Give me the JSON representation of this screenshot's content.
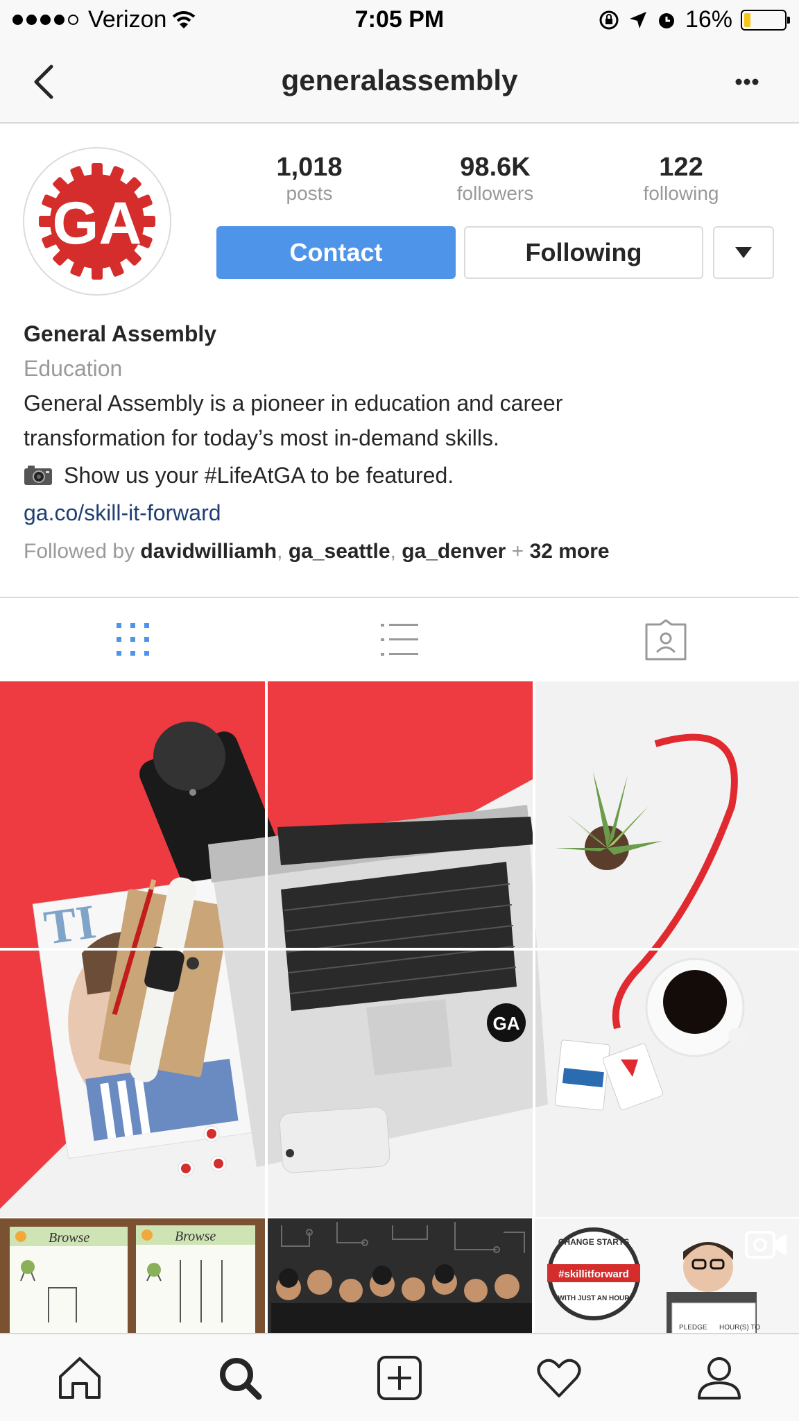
{
  "status_bar": {
    "carrier": "Verizon",
    "time": "7:05 PM",
    "battery": "16%",
    "battery_level": 0.16,
    "battery_color": "#f5c518"
  },
  "nav": {
    "title": "generalassembly",
    "back_icon": "chevron-left-icon",
    "more_icon": "more-dots-icon"
  },
  "profile": {
    "avatar_text": "GA",
    "avatar_color": "#d52c2c",
    "stats": [
      {
        "value": "1,018",
        "label": "posts"
      },
      {
        "value": "98.6K",
        "label": "followers"
      },
      {
        "value": "122",
        "label": "following"
      }
    ],
    "contact_label": "Contact",
    "following_label": "Following",
    "accent_color": "#4e95ea"
  },
  "bio": {
    "name": "General Assembly",
    "category": "Education",
    "line1": "General Assembly is a pioneer in education and career",
    "line2": "transformation for today’s most in-demand skills.",
    "line3": "Show us your #LifeAtGA to be featured.",
    "link": "ga.co/skill-it-forward",
    "followed_prefix": "Followed by ",
    "followed_users": [
      "davidwilliamh",
      "ga_seattle",
      "ga_denver"
    ],
    "followed_more": "32 more"
  },
  "tabs": [
    {
      "icon": "grid-icon",
      "active": true
    },
    {
      "icon": "list-icon",
      "active": false
    },
    {
      "icon": "tagged-icon",
      "active": false
    }
  ],
  "grid_posts": {
    "post7": {
      "labels": [
        "Browse",
        "Browse"
      ]
    },
    "post9": {
      "badge_top": "CHANGE STARTS",
      "badge_mid": "#skillitforward",
      "badge_bottom": "WITH JUST AN HOUR",
      "pledge": "PLEDGE",
      "hours": "HOUR(S) TO",
      "icon": "video-icon"
    }
  },
  "tab_bar": [
    {
      "icon": "home-icon"
    },
    {
      "icon": "search-icon"
    },
    {
      "icon": "add-post-icon"
    },
    {
      "icon": "heart-icon"
    },
    {
      "icon": "profile-icon"
    }
  ]
}
